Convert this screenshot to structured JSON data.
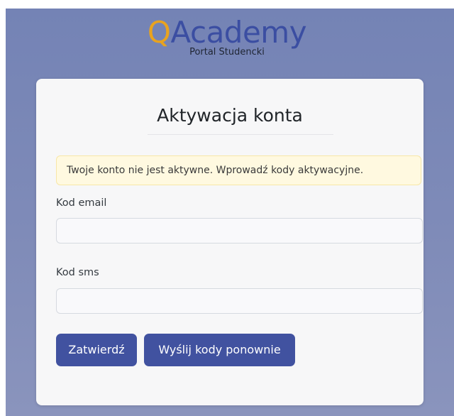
{
  "logo": {
    "q_letter": "Q",
    "rest": "Academy",
    "subtitle": "Portal Studencki",
    "q_color": "#e9a31f",
    "rest_color": "#3b4ea2"
  },
  "card": {
    "title": "Aktywacja konta",
    "alert": "Twoje konto nie jest aktywne. Wprowadź kody aktywacyjne.",
    "email_label": "Kod email",
    "email_value": "",
    "sms_label": "Kod sms",
    "sms_value": "",
    "submit_label": "Zatwierdź",
    "resend_label": "Wyślij kody ponownie"
  },
  "colors": {
    "background": "#7f8bb8",
    "button": "#4152a0",
    "alert_bg": "#fff9e0"
  }
}
